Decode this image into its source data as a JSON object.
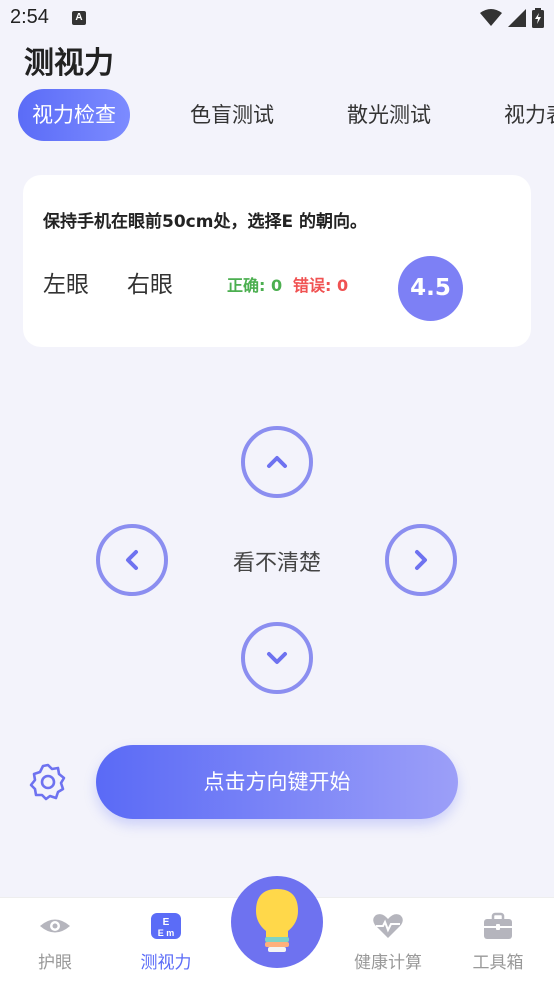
{
  "status_bar": {
    "time": "2:54",
    "notification_icon": "a-icon"
  },
  "header": {
    "title": "测视力"
  },
  "tabs": [
    {
      "label": "视力检查",
      "active": true
    },
    {
      "label": "色盲测试",
      "active": false
    },
    {
      "label": "散光测试",
      "active": false
    },
    {
      "label": "视力表",
      "active": false
    }
  ],
  "card": {
    "instruction": "保持手机在眼前50cm处，选择E 的朝向。",
    "left_eye": "左眼",
    "right_eye": "右眼",
    "correct_label": "正确: 0",
    "wrong_label": "错误: 0",
    "score": "4.5"
  },
  "controls": {
    "cant_see_label": "看不清楚",
    "start_button_label": "点击方向键开始"
  },
  "bottom_nav": {
    "items": [
      {
        "label": "护眼",
        "icon": "eye-icon",
        "active": false
      },
      {
        "label": "测视力",
        "icon": "eye-chart-icon",
        "active": true
      },
      {
        "label": "健康计算",
        "icon": "heart-pulse-icon",
        "active": false
      },
      {
        "label": "工具箱",
        "icon": "toolbox-icon",
        "active": false
      }
    ],
    "center_icon": "lightbulb-icon"
  },
  "colors": {
    "accent": "#5b6cf7",
    "score_bg": "#7d80f5",
    "ring": "#8b8ef0",
    "correct": "#4caf50",
    "wrong": "#f05252",
    "background": "#f3f3fb"
  }
}
